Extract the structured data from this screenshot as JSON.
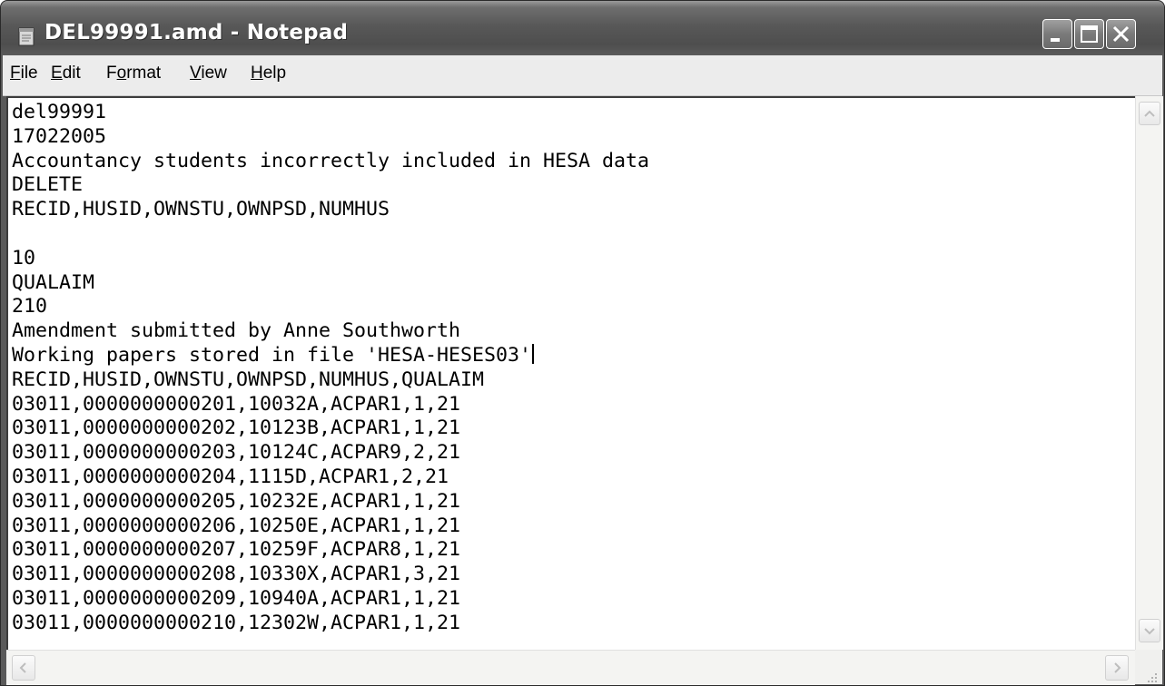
{
  "window": {
    "title": "DEL99991.amd - Notepad",
    "colors": {
      "titlebar": "#585858",
      "menubar": "#ececec",
      "editor_bg": "#ffffff"
    }
  },
  "menu": {
    "items": [
      {
        "id": "file",
        "prefix": "",
        "accel": "F",
        "rest": "ile"
      },
      {
        "id": "edit",
        "prefix": "",
        "accel": "E",
        "rest": "dit"
      },
      {
        "id": "format",
        "prefix": "F",
        "accel": "o",
        "rest": "rmat"
      },
      {
        "id": "view",
        "prefix": "",
        "accel": "V",
        "rest": "iew"
      },
      {
        "id": "help",
        "prefix": "",
        "accel": "H",
        "rest": "elp"
      }
    ]
  },
  "editor": {
    "lines": [
      "del99991",
      "17022005",
      "Accountancy students incorrectly included in HESA data",
      "DELETE",
      "RECID,HUSID,OWNSTU,OWNPSD,NUMHUS",
      "",
      "10",
      "QUALAIM",
      "210",
      "Amendment submitted by Anne Southworth",
      "Working papers stored in file 'HESA-HESES03'",
      "RECID,HUSID,OWNSTU,OWNPSD,NUMHUS,QUALAIM",
      "03011,0000000000201,10032A,ACPAR1,1,21",
      "03011,0000000000202,10123B,ACPAR1,1,21",
      "03011,0000000000203,10124C,ACPAR9,2,21",
      "03011,0000000000204,1115D,ACPAR1,2,21",
      "03011,0000000000205,10232E,ACPAR1,1,21",
      "03011,0000000000206,10250E,ACPAR1,1,21",
      "03011,0000000000207,10259F,ACPAR8,1,21",
      "03011,0000000000208,10330X,ACPAR1,3,21",
      "03011,0000000000209,10940A,ACPAR1,1,21",
      "03011,0000000000210,12302W,ACPAR1,1,21"
    ],
    "caret_line": 10
  },
  "icons": {
    "app": "notepad-icon",
    "minimize": "minimize-icon",
    "maximize": "maximize-icon",
    "close": "close-icon",
    "scroll_up": "arrow-up-icon",
    "scroll_down": "arrow-down-icon",
    "scroll_left": "arrow-left-icon",
    "scroll_right": "arrow-right-icon",
    "resize": "size-grip-icon"
  }
}
